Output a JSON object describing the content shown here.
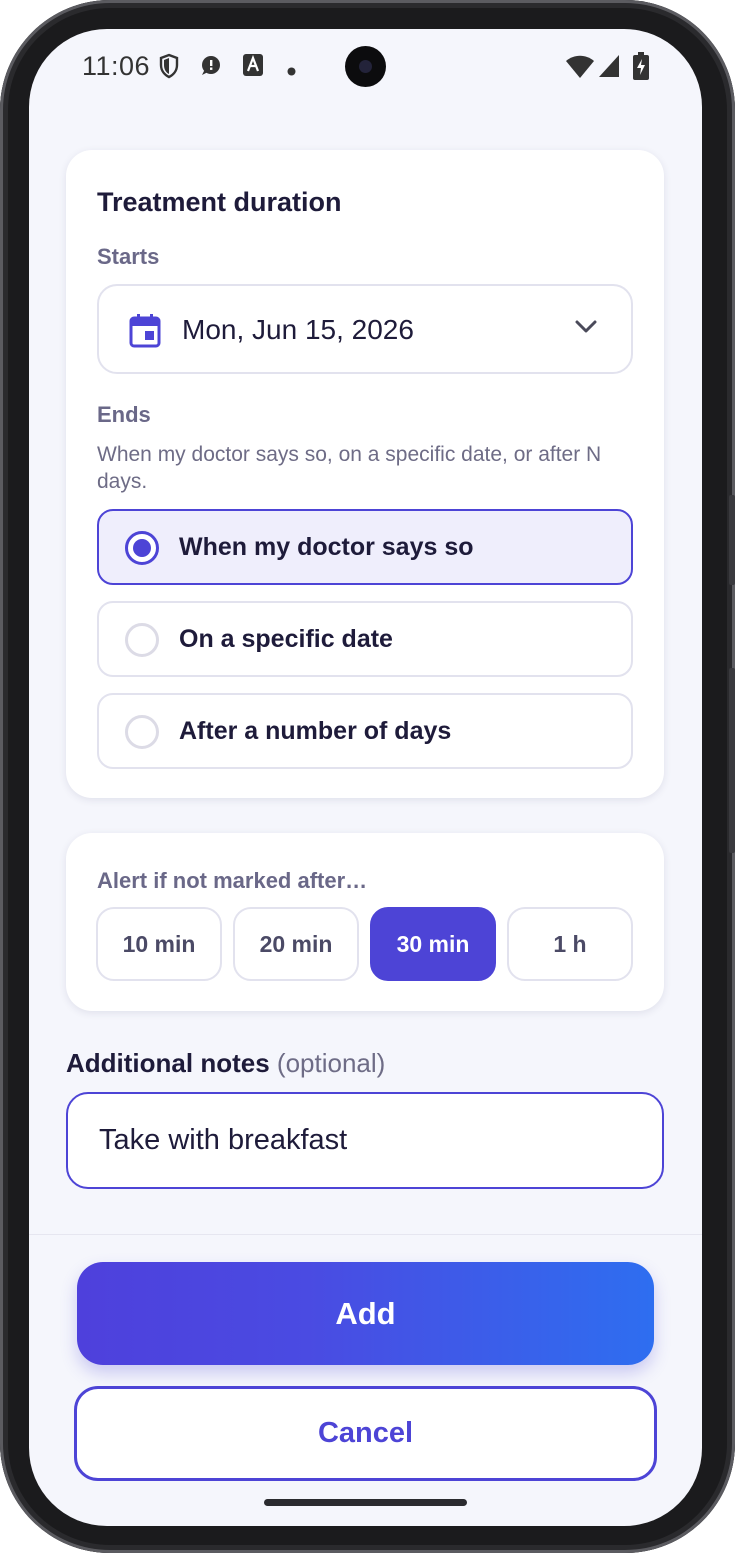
{
  "status_bar": {
    "time": "11:06",
    "left_icons": [
      "shield-icon",
      "chat-bubble-icon",
      "font-a-icon",
      "dot-icon"
    ],
    "right_icons": [
      "wifi-icon",
      "cellular-signal-icon",
      "battery-charging-icon"
    ]
  },
  "treatment": {
    "title": "Treatment duration",
    "starts_label": "Starts",
    "start_date": "Mon, Jun 15, 2026",
    "ends_label": "Ends",
    "ends_helper": "When my doctor says so, on a specific date, or after N days.",
    "options": [
      {
        "label": "When my doctor says so",
        "selected": true
      },
      {
        "label": "On a specific date",
        "selected": false
      },
      {
        "label": "After a number of days",
        "selected": false
      }
    ]
  },
  "alert": {
    "label": "Alert if not marked after…",
    "chips": [
      {
        "label": "10 min",
        "selected": false
      },
      {
        "label": "20 min",
        "selected": false
      },
      {
        "label": "30 min",
        "selected": true
      },
      {
        "label": "1 h",
        "selected": false
      }
    ]
  },
  "notes": {
    "label": "Additional notes",
    "optional_hint": "(optional)",
    "value": "Take with breakfast"
  },
  "actions": {
    "add_label": "Add",
    "cancel_label": "Cancel"
  },
  "colors": {
    "accent": "#4d44d6",
    "add_gradient_end": "#2e6ef0",
    "screen_background": "#f5f6fc"
  }
}
